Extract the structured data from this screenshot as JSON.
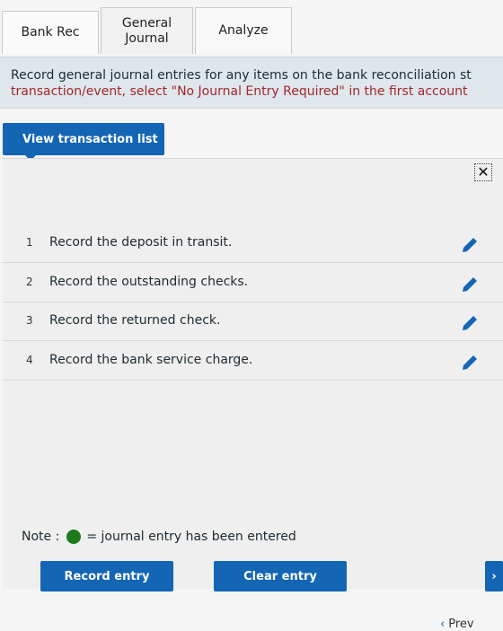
{
  "tabs": [
    {
      "label": "Bank Rec"
    },
    {
      "label": "General\nJournal"
    },
    {
      "label": "Analyze"
    }
  ],
  "instructions": {
    "line1": "Record general journal entries for any items on the bank reconciliation st",
    "line2": "transaction/event, select \"No Journal Entry Required\" in the first account"
  },
  "view_button": {
    "label": "View transaction list"
  },
  "transactions": [
    {
      "num": "1",
      "text": "Record the deposit in transit."
    },
    {
      "num": "2",
      "text": "Record the outstanding checks."
    },
    {
      "num": "3",
      "text": "Record the returned check."
    },
    {
      "num": "4",
      "text": "Record the bank service charge."
    }
  ],
  "note": {
    "label": "Note :",
    "text": "= journal entry has been entered",
    "dot_color": "#1d7a1d"
  },
  "buttons": {
    "record": "Record entry",
    "clear": "Clear entry"
  },
  "footer": {
    "prev": "Prev"
  },
  "colors": {
    "accent": "#1565b5",
    "instruction_red": "#a3272e",
    "instruction_bg": "#dfe7ec"
  }
}
